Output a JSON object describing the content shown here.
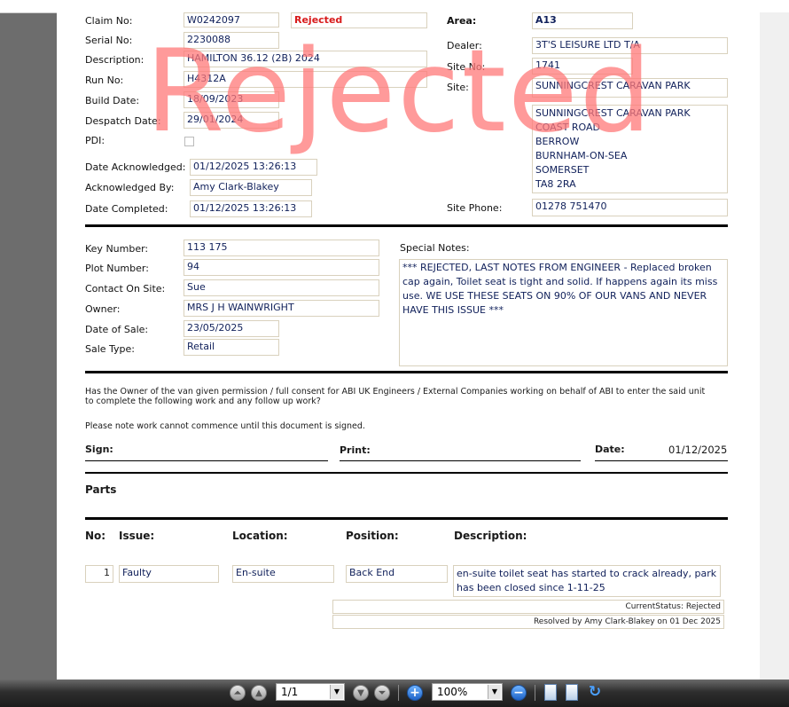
{
  "claim": {
    "claim_no_label": "Claim No:",
    "claim_no": "W0242097",
    "status_flag": "Rejected",
    "serial_no_label": "Serial No:",
    "serial_no": "2230088",
    "description_label": "Description:",
    "description": "HAMILTON 36.12 (2B) 2024",
    "run_no_label": "Run No:",
    "run_no": "H4312A",
    "build_date_label": "Build Date:",
    "build_date": "18/09/2023",
    "despatch_date_label": "Despatch Date:",
    "despatch_date": "29/01/2024",
    "pdi_label": "PDI:",
    "date_ack_label": "Date Acknowledged:",
    "date_ack": "01/12/2025 13:26:13",
    "ack_by_label": "Acknowledged By:",
    "ack_by": "Amy Clark-Blakey",
    "date_completed_label": "Date Completed:",
    "date_completed": "01/12/2025 13:26:13"
  },
  "site": {
    "area_label": "Area:",
    "area": "A13",
    "dealer_label": "Dealer:",
    "dealer": "3T'S LEISURE LTD T/A",
    "site_no_label": "Site No:",
    "site_no": "1741",
    "site_label": "Site:",
    "site": "SUNNINGCREST CARAVAN PARK",
    "address": [
      "SUNNINGCREST CARAVAN PARK",
      "COAST ROAD",
      "BERROW",
      "BURNHAM-ON-SEA",
      "SOMERSET",
      "TA8 2RA"
    ],
    "site_phone_label": "Site Phone:",
    "site_phone": "01278 751470"
  },
  "stamp_text": "Rejected",
  "owner": {
    "key_number_label": "Key Number:",
    "key_number": "113 175",
    "plot_number_label": "Plot Number:",
    "plot_number": "94",
    "contact_label": "Contact On Site:",
    "contact": "Sue",
    "owner_label": "Owner:",
    "owner": "MRS J H WAINWRIGHT",
    "date_of_sale_label": "Date of Sale:",
    "date_of_sale": "23/05/2025",
    "sale_type_label": "Sale Type:",
    "sale_type": "Retail",
    "special_notes_label": "Special Notes:",
    "special_notes": "*** REJECTED, LAST NOTES FROM ENGINEER -  Replaced broken cap again, Toilet seat is tight and solid.  If happens again its miss use. WE USE THESE SEATS ON 90% OF OUR VANS AND NEVER HAVE THIS ISSUE ***"
  },
  "consent": {
    "permission_text": "Has the Owner of the van given permission / full consent for ABI UK Engineers / External Companies working on behalf of ABI to enter the said unit to complete the following work and any follow up work?",
    "note_text": "Please note work cannot commence until this document is signed.",
    "sign_label": "Sign:",
    "print_label": "Print:",
    "date_label": "Date:",
    "date_value": "01/12/2025"
  },
  "parts": {
    "heading": "Parts",
    "headers": {
      "no": "No:",
      "issue": "Issue:",
      "location": "Location:",
      "position": "Position:",
      "description": "Description:"
    },
    "rows": [
      {
        "no": "1",
        "issue": "Faulty",
        "location": "En-suite",
        "position": "Back End",
        "description": "en-suite toilet seat has started to crack already, park has been closed since 1-11-25"
      }
    ],
    "current_status": "CurrentStatus: Rejected",
    "resolved_by": "Resolved by Amy Clark-Blakey on 01 Dec 2025"
  },
  "viewer": {
    "page_indicator": "1/1",
    "zoom_level": "100%"
  }
}
